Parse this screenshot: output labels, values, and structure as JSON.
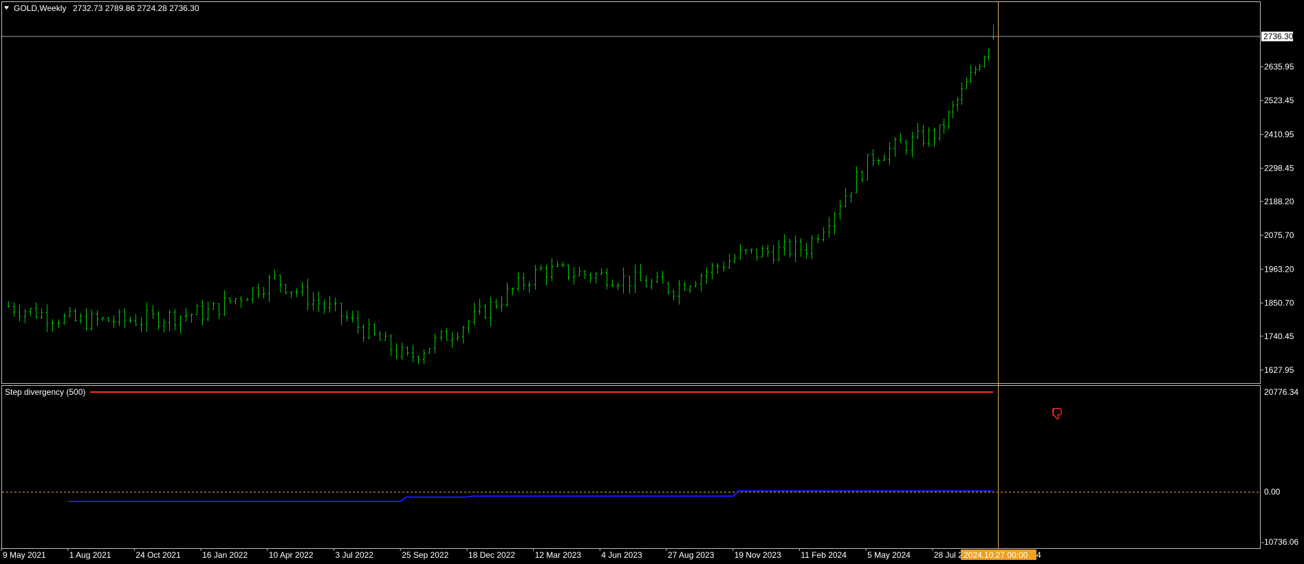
{
  "header": {
    "symbol_timeframe": "GOLD,Weekly",
    "ohlc": "2732.73 2789.86 2724.28 2736.30",
    "dropdown_icon": "triangle-down-icon"
  },
  "indicator": {
    "label": "Step divergency (500)",
    "scale_top": "20776.34",
    "scale_zero": "0.00",
    "scale_bottom": "-10736.06",
    "marker_icon": "thumbs-down-icon",
    "colors": {
      "signal": "#ff2a2a",
      "line": "#1a1aff",
      "zero": "#e8a84e"
    }
  },
  "price_axis": {
    "labels": [
      "2635.95",
      "2523.45",
      "2410.95",
      "2298.45",
      "2188.20",
      "2075.70",
      "1963.20",
      "1850.70",
      "1740.45",
      "1627.95"
    ],
    "current_price": "2736.30"
  },
  "time_axis": {
    "labels": [
      "9 May 2021",
      "1 Aug 2021",
      "24 Oct 2021",
      "16 Jan 2022",
      "10 Apr 2022",
      "3 Jul 2022",
      "25 Sep 2022",
      "18 Dec 2022",
      "12 Mar 2023",
      "4 Jun 2023",
      "27 Aug 2023",
      "19 Nov 2023",
      "11 Feb 2024",
      "5 May 2024",
      "28 Jul 20"
    ],
    "crosshair_time": "2024.10.27 00:00"
  },
  "colors": {
    "background": "#000000",
    "bars": "#00cc00",
    "crosshair": "#e8a84e",
    "grid_border": "#c0c0c0"
  },
  "chart_data": [
    {
      "type": "ohlc",
      "symbol": "GOLD",
      "timeframe": "Weekly",
      "ylim": [
        1627.95,
        2736.3
      ],
      "x_labels": [
        "9 May 2021",
        "1 Aug 2021",
        "24 Oct 2021",
        "16 Jan 2022",
        "10 Apr 2022",
        "3 Jul 2022",
        "25 Sep 2022",
        "18 Dec 2022",
        "12 Mar 2023",
        "4 Jun 2023",
        "27 Aug 2023",
        "19 Nov 2023",
        "11 Feb 2024",
        "5 May 2024",
        "28 Jul 2024"
      ],
      "close_by_label": [
        1840,
        1790,
        1795,
        1820,
        1930,
        1810,
        1665,
        1800,
        1960,
        1940,
        1900,
        2010,
        2035,
        2340,
        2420
      ],
      "last_bar": {
        "open": 2732.73,
        "high": 2789.86,
        "low": 2724.28,
        "close": 2736.3
      }
    },
    {
      "type": "line",
      "title": "Step divergency (500)",
      "ylim": [
        -10736.06,
        20776.34
      ],
      "series": [
        {
          "values_by_label": [
            -2200,
            -2200,
            -2200,
            -2200,
            -2200,
            -2200,
            -1300,
            -1100,
            -1100,
            -1100,
            -1100,
            0,
            0,
            0,
            0
          ]
        },
        {
          "values_by_label": [
            20776.34,
            20776.34,
            20776.34,
            20776.34,
            20776.34,
            20776.34,
            20776.34,
            20776.34,
            20776.34,
            20776.34,
            20776.34,
            20776.34,
            20776.34,
            20776.34,
            20776.34
          ]
        }
      ]
    }
  ]
}
